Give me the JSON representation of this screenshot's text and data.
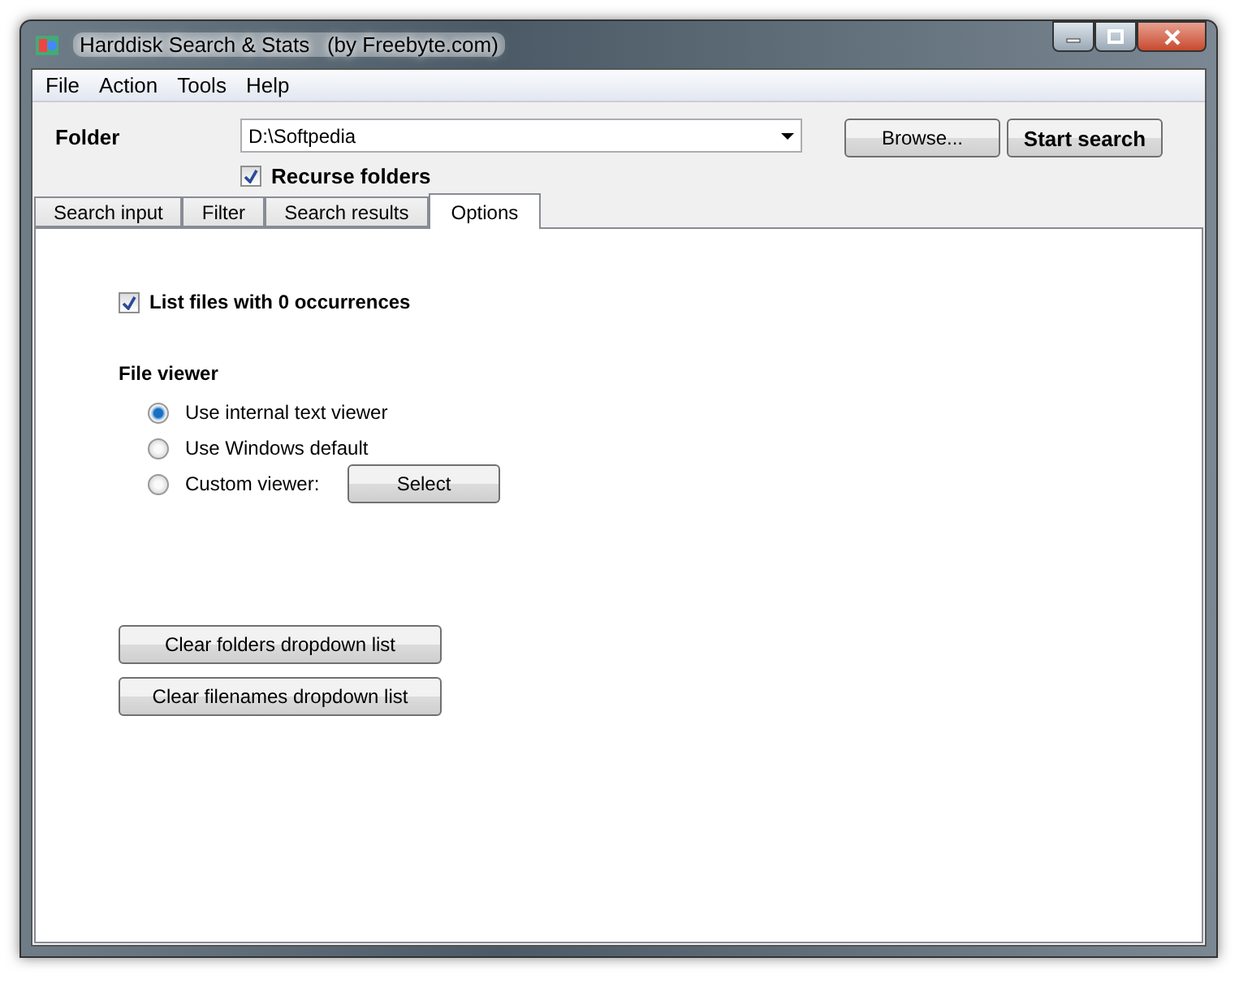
{
  "window": {
    "title": "Harddisk Search & Stats   (by Freebyte.com)"
  },
  "menu": [
    "File",
    "Action",
    "Tools",
    "Help"
  ],
  "folder": {
    "label": "Folder",
    "value": "D:\\Softpedia"
  },
  "buttons": [
    "Browse...",
    "Start search"
  ],
  "recurse": {
    "label": "Recurse folders",
    "checked": true
  },
  "tabs": [
    {
      "label": "Search input",
      "selected": false
    },
    {
      "label": "Filter",
      "selected": false
    },
    {
      "label": "Search results",
      "selected": false
    },
    {
      "label": "Options",
      "selected": true
    }
  ],
  "options": {
    "list_zero": {
      "label": "List files with 0 occurrences",
      "checked": true
    },
    "file_viewer": {
      "heading": "File viewer",
      "choices": [
        {
          "label": "Use internal text viewer",
          "selected": true
        },
        {
          "label": "Use Windows default",
          "selected": false
        },
        {
          "label": "Custom viewer:",
          "selected": false
        }
      ],
      "select_button": "Select"
    },
    "clear_buttons": [
      "Clear folders dropdown list",
      "Clear filenames dropdown list"
    ]
  }
}
